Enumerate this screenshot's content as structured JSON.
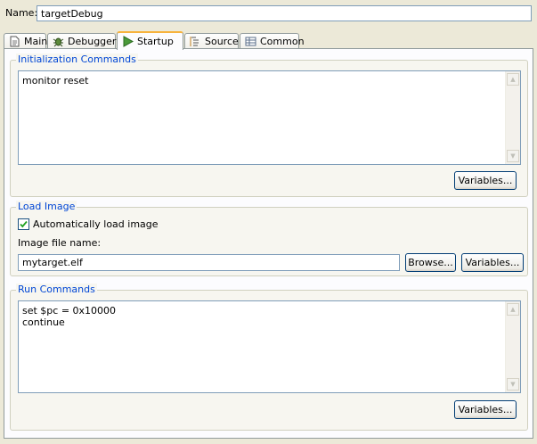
{
  "name": {
    "label": "Name:",
    "value": "targetDebug"
  },
  "tabs": [
    {
      "label": "Main",
      "icon": "page-icon"
    },
    {
      "label": "Debugger",
      "icon": "bug-icon"
    },
    {
      "label": "Startup",
      "icon": "play-icon",
      "active": true
    },
    {
      "label": "Source",
      "icon": "source-icon"
    },
    {
      "label": "Common",
      "icon": "table-icon"
    }
  ],
  "init": {
    "title": "Initialization Commands",
    "text": "monitor reset",
    "variables_label": "Variables..."
  },
  "load": {
    "title": "Load Image",
    "auto_label": "Automatically load image",
    "auto_checked": true,
    "file_label": "Image file name:",
    "file_value": "mytarget.elf",
    "browse_label": "Browse...",
    "variables_label": "Variables..."
  },
  "run": {
    "title": "Run Commands",
    "text": "set $pc = 0x10000\ncontinue",
    "variables_label": "Variables..."
  },
  "colors": {
    "group_title": "#0046d5",
    "active_tab_accent": "#f7b33d",
    "background": "#ece9d8"
  }
}
